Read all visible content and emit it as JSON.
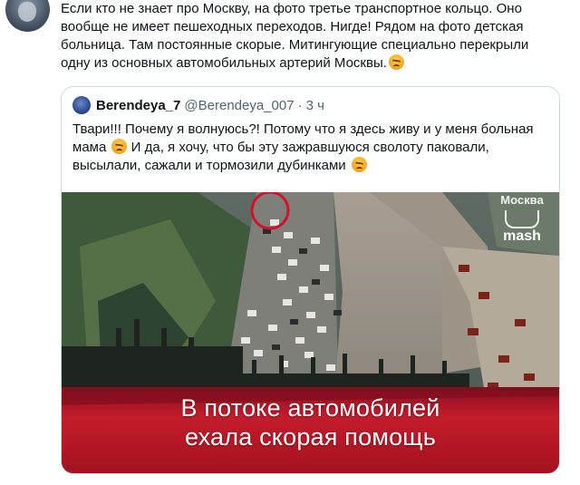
{
  "tweet": {
    "text": "Если кто не знает про Москву, на фото третье транспортное кольцо. Оно вообще не имеет пешеходных переходов. Нигде! Рядом на фото детская больница. Там постоянные скорые. Митингующие специально перекрыли одну из основных автомобильных артерий Москвы.",
    "emoji": "angry-face-emoji"
  },
  "quote": {
    "name": "Berendeya_7",
    "handle": "@Berendeya_007",
    "separator": "·",
    "time": "3 ч",
    "text_part1": "Твари!!! Почему я волнуюсь?! Потому что я здесь живу и у меня больная мама",
    "text_part2": "И да, я хочу, что бы эту зажравшуюся сволоту паковали, высылали, сажали и тормозили дубинками",
    "emoji": "angry-face-emoji"
  },
  "media": {
    "caption_line1": "В потоке автомобилей",
    "caption_line2": "ехала скорая помощь",
    "logo_top": "Москва",
    "logo_text": "mash",
    "highlight_color": "#d4102a",
    "caption_band_color": "#c81f2e"
  }
}
